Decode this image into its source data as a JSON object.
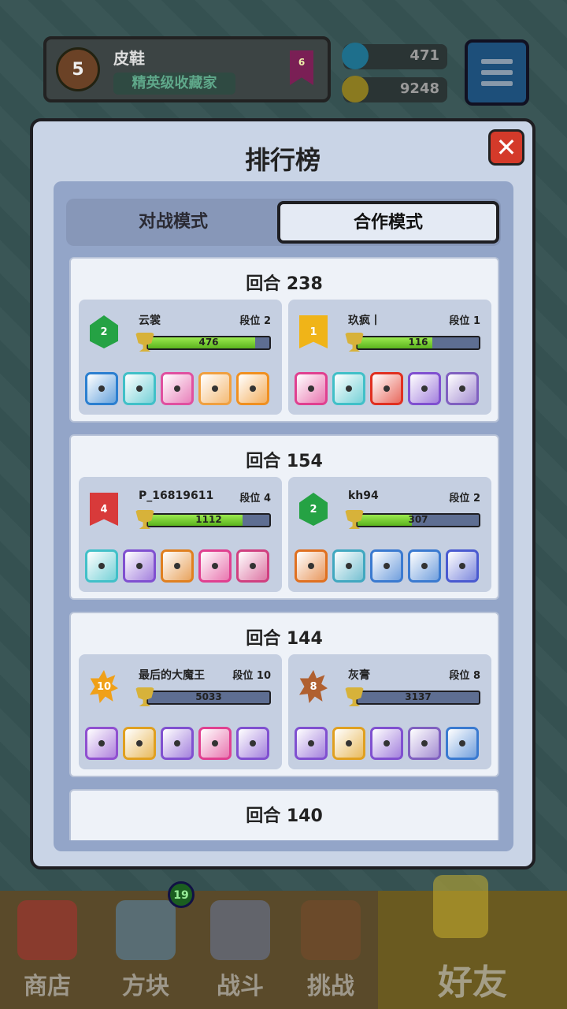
{
  "topbar": {
    "level": "5",
    "player_name": "皮鞋",
    "player_title": "精英级收藏家",
    "rank_flag": "6",
    "gems": "471",
    "coins": "9248",
    "icons": {
      "gem": "gem-icon",
      "coin": "coin-icon",
      "menu": "menu-icon"
    }
  },
  "modal": {
    "title": "排行榜",
    "close": "✕",
    "tabs": [
      {
        "label": "对战模式",
        "selected": false
      },
      {
        "label": "合作模式",
        "selected": true
      }
    ]
  },
  "entries": [
    {
      "round": "回合 238",
      "players": [
        {
          "rank_badge": "2",
          "badge_color": "#25a244",
          "badge_shape": "ribbon",
          "name": "云裳",
          "tier": "段位 2",
          "score": "476",
          "fill": 0.88,
          "dice": [
            "#2b7fd0",
            "#41c0c8",
            "#e050a0",
            "#f0a040",
            "#f09020"
          ]
        },
        {
          "rank_badge": "1",
          "badge_color": "#f0b418",
          "badge_shape": "flag",
          "name": "玖疯丨",
          "tier": "段位 1",
          "score": "116",
          "fill": 0.62,
          "dice": [
            "#e04090",
            "#41c0c8",
            "#e03020",
            "#8050d0",
            "#8060c0"
          ]
        }
      ]
    },
    {
      "round": "回合 154",
      "players": [
        {
          "rank_badge": "4",
          "badge_color": "#d83a3a",
          "badge_shape": "flag",
          "name": "P_16819611",
          "tier": "段位 4",
          "score": "1112",
          "fill": 0.78,
          "dice": [
            "#41c0c8",
            "#8050d0",
            "#e08020",
            "#e04090",
            "#d04080"
          ]
        },
        {
          "rank_badge": "2",
          "badge_color": "#25a244",
          "badge_shape": "ribbon",
          "name": "kh94",
          "tier": "段位 2",
          "score": "307",
          "fill": 0.45,
          "dice": [
            "#e07020",
            "#41a8c0",
            "#3a7ad0",
            "#3a7ad0",
            "#4a5ad0"
          ]
        }
      ]
    },
    {
      "round": "回合 144",
      "players": [
        {
          "rank_badge": "10",
          "badge_color": "#f0a018",
          "badge_shape": "burst",
          "name": "最后的大魔王",
          "tier": "段位 10",
          "score": "5033",
          "fill": 0.0,
          "dice": [
            "#9050d0",
            "#e0a020",
            "#8050d0",
            "#e04090",
            "#8050d0"
          ]
        },
        {
          "rank_badge": "8",
          "badge_color": "#b06030",
          "badge_shape": "burst",
          "name": "灰膏",
          "tier": "段位 8",
          "score": "3137",
          "fill": 0.0,
          "dice": [
            "#8050d0",
            "#e0a020",
            "#8050d0",
            "#8060c0",
            "#3a7ad0"
          ]
        }
      ]
    },
    {
      "round": "回合 140",
      "players": []
    }
  ],
  "bottomnav": {
    "items": [
      {
        "label": "商店",
        "icon": "shop-icon"
      },
      {
        "label": "方块",
        "icon": "cube-icon"
      },
      {
        "label": "战斗",
        "icon": "battle-icon"
      },
      {
        "label": "挑战",
        "icon": "challenge-icon"
      },
      {
        "label": "好友",
        "icon": "friends-icon"
      }
    ],
    "cube_badge": "19"
  }
}
